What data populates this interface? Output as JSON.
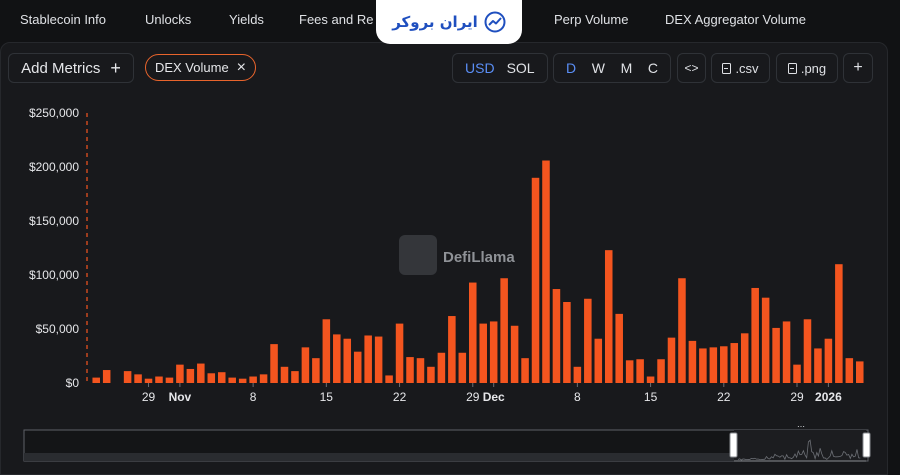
{
  "nav": {
    "tabs": [
      "Stablecoin Info",
      "Unlocks",
      "Yields",
      "Fees and Re",
      "Perp Volume",
      "DEX Aggregator Volume"
    ],
    "brand": "ایران بروکر"
  },
  "toolbar": {
    "add_metrics_label": "Add Metrics",
    "add_metrics_icon": "+",
    "metric_chip_label": "DEX Volume",
    "metric_chip_remove_icon": "×",
    "currency_options": [
      "USD",
      "SOL"
    ],
    "currency_selected": "USD",
    "interval_options": [
      "D",
      "W",
      "M",
      "C"
    ],
    "interval_selected": "D",
    "embed_icon": "<>",
    "csv_label": ".csv",
    "png_label": ".png",
    "more_icon": "+"
  },
  "colors": {
    "bar": "#f4551f",
    "accent": "#5a8ef5",
    "chip_border": "#e8642c"
  },
  "chart_data": {
    "type": "bar",
    "watermark": "DefiLlama",
    "y_ticks": [
      "$250,000",
      "$200,000",
      "$150,000",
      "$100,000",
      "$50,000",
      "$0"
    ],
    "ylim": [
      0,
      250000
    ],
    "x_ticks": [
      {
        "label": "29",
        "index": 5
      },
      {
        "label": "Nov",
        "index": 8,
        "bold": true
      },
      {
        "label": "8",
        "index": 15
      },
      {
        "label": "15",
        "index": 22
      },
      {
        "label": "22",
        "index": 29
      },
      {
        "label": "29",
        "index": 36
      },
      {
        "label": "Dec",
        "index": 38,
        "bold": true
      },
      {
        "label": "8",
        "index": 46
      },
      {
        "label": "15",
        "index": 53
      },
      {
        "label": "22",
        "index": 60
      },
      {
        "label": "29",
        "index": 67
      },
      {
        "label": "2026",
        "index": 70,
        "bold": true
      }
    ],
    "values": [
      5000,
      12000,
      0,
      11000,
      8000,
      4000,
      6000,
      5000,
      17000,
      13000,
      18000,
      9000,
      10000,
      5000,
      4000,
      6000,
      8000,
      36000,
      15000,
      11000,
      33000,
      23000,
      59000,
      45000,
      41000,
      29000,
      44000,
      43000,
      7000,
      55000,
      24000,
      23000,
      15000,
      28000,
      62000,
      28000,
      93000,
      55000,
      57000,
      97000,
      53000,
      23000,
      190000,
      206000,
      87000,
      75000,
      15000,
      78000,
      41000,
      123000,
      64000,
      21000,
      22000,
      6000,
      22000,
      42000,
      97000,
      39000,
      32000,
      33000,
      34000,
      37000,
      46000,
      88000,
      79000,
      51000,
      57000,
      17000,
      59000,
      32000,
      41000,
      110000,
      23000,
      20000
    ]
  }
}
